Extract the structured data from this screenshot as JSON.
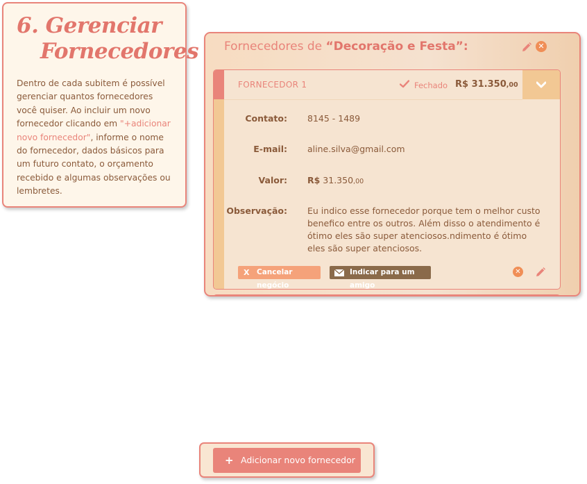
{
  "info": {
    "title_line1": "6. Gerenciar",
    "title_line2": "Fornecedores",
    "text_part1": "Dentro de cada subitem é possível gerenciar quantos fornecedores você quiser. Ao incluir um novo fornecedor clicando em ",
    "text_link": "\"+adicionar novo fornecedor\"",
    "text_part2": ", informe o nome do fornecedor, dados básicos para um futuro contato, o orçamento recebido e algumas observações ou lembretes."
  },
  "panel": {
    "title_prefix": "Fornecedores de ",
    "title_category": "“Decoração e Festa”:"
  },
  "supplier": {
    "name": "FORNECEDOR 1",
    "status": "Fechado",
    "value_main": "R$ 31.350",
    "value_cents": ",00",
    "contact_label": "Contato:",
    "contact_value": "8145 - 1489",
    "email_label": "E-mail:",
    "email_value": "aline.silva@gmail.com",
    "value_label": "Valor:",
    "value_currency": "R$",
    "value_amount": " 31.350",
    "value_amount_cents": ",00",
    "note_label": "Observação:",
    "note_value": "Eu indico esse fornecedor porque tem o melhor custo benefico entre os outros. Além disso o atendimento é ótimo eles são super atenciosos.ndimento é ótimo eles são super atenciosos.",
    "cancel_label": "Cancelar negócio",
    "cancel_glyph": "X",
    "refer_label": "Indicar para um amigo"
  },
  "add_button": {
    "label": "Adicionar novo fornecedor",
    "glyph": "+"
  },
  "colors": {
    "accent": "#e9847a",
    "text_brown": "#8a5a3a",
    "orange": "#f08e56",
    "tan": "#f2c894"
  },
  "icons": [
    "pencil-icon",
    "close-circle-icon",
    "check-icon",
    "chevron-down-icon",
    "envelope-icon",
    "plus-icon"
  ]
}
